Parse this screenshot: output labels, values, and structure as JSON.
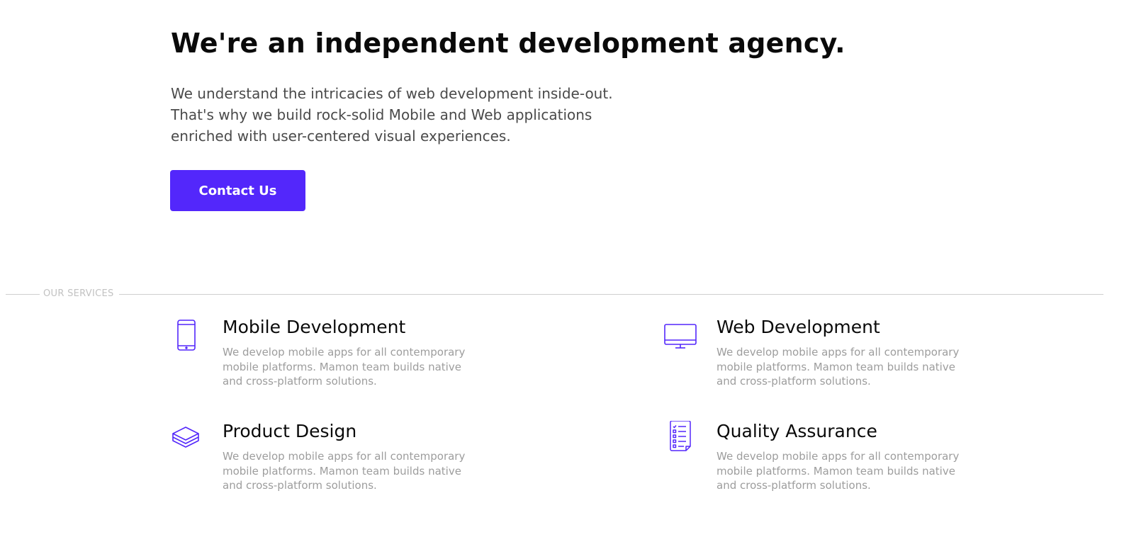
{
  "hero": {
    "title": "We're an independent development agency.",
    "lede": "We understand the intricacies of web development inside-out.\nThat's why we build rock-solid Mobile and Web applications\nenriched with user-centered visual experiences.",
    "cta_label": "Contact Us"
  },
  "services_section": {
    "label": "OUR SERVICES",
    "items": [
      {
        "title": "Mobile Development",
        "description": "We develop mobile apps for all contemporary\nmobile platforms. Mamon team builds native\nand cross-platform solutions.",
        "icon": "mobile-phone-icon"
      },
      {
        "title": "Web Development",
        "description": "We develop mobile apps for all contemporary\nmobile platforms. Mamon team builds native\nand cross-platform solutions.",
        "icon": "desktop-monitor-icon"
      },
      {
        "title": "Product Design",
        "description": "We develop mobile apps for all contemporary\nmobile platforms. Mamon team builds native\nand cross-platform solutions.",
        "icon": "layers-icon"
      },
      {
        "title": "Quality Assurance",
        "description": "We develop mobile apps for all contemporary\nmobile platforms. Mamon team builds native\nand cross-platform solutions.",
        "icon": "checklist-icon"
      }
    ]
  },
  "colors": {
    "accent": "#5327fb",
    "heading": "#0a0a0a",
    "body_text": "#4a4a4a",
    "muted_text": "#9d9d9d",
    "divider": "#cfcfcf"
  }
}
